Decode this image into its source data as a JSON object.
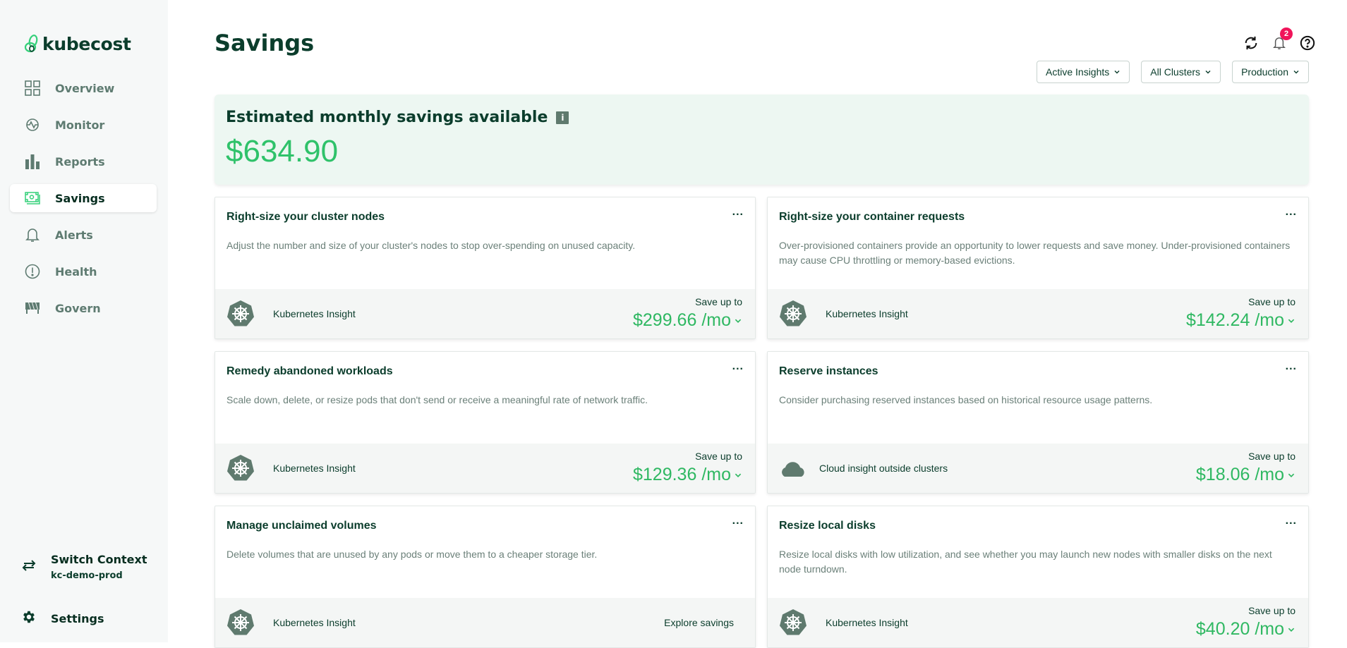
{
  "app": {
    "logo_text": "kubecost"
  },
  "sidebar": {
    "items": [
      {
        "label": "Overview",
        "icon": "grid-icon",
        "active": false
      },
      {
        "label": "Monitor",
        "icon": "pulse-icon",
        "active": false
      },
      {
        "label": "Reports",
        "icon": "bar-chart-icon",
        "active": false
      },
      {
        "label": "Savings",
        "icon": "money-icon",
        "active": true
      },
      {
        "label": "Alerts",
        "icon": "bell-icon",
        "active": false
      },
      {
        "label": "Health",
        "icon": "alert-circle-icon",
        "active": false
      },
      {
        "label": "Govern",
        "icon": "govern-icon",
        "active": false
      }
    ],
    "switch_context": {
      "title": "Switch Context",
      "context": "kc-demo-prod"
    },
    "settings_label": "Settings"
  },
  "header": {
    "title": "Savings",
    "notification_count": "2",
    "filters": [
      {
        "label": "Active Insights"
      },
      {
        "label": "All Clusters"
      },
      {
        "label": "Production"
      }
    ]
  },
  "banner": {
    "title": "Estimated monthly savings available",
    "info_icon": "i",
    "amount": "$634.90"
  },
  "cards": [
    {
      "title": "Right-size your cluster nodes",
      "description": "Adjust the number and size of your cluster's nodes to stop over-spending on unused capacity.",
      "source": "Kubernetes Insight",
      "source_type": "kubernetes",
      "save_label": "Save up to",
      "amount": "$299.66 /mo",
      "more": "..."
    },
    {
      "title": "Right-size your container requests",
      "description": "Over-provisioned containers provide an opportunity to lower requests and save money. Under-provisioned containers may cause CPU throttling or memory-based evictions.",
      "source": "Kubernetes Insight",
      "source_type": "kubernetes",
      "save_label": "Save up to",
      "amount": "$142.24 /mo",
      "more": "..."
    },
    {
      "title": "Remedy abandoned workloads",
      "description": "Scale down, delete, or resize pods that don't send or receive a meaningful rate of network traffic.",
      "source": "Kubernetes Insight",
      "source_type": "kubernetes",
      "save_label": "Save up to",
      "amount": "$129.36 /mo",
      "more": "..."
    },
    {
      "title": "Reserve instances",
      "description": "Consider purchasing reserved instances based on historical resource usage patterns.",
      "source": "Cloud insight outside clusters",
      "source_type": "cloud",
      "save_label": "Save up to",
      "amount": "$18.06 /mo",
      "more": "..."
    },
    {
      "title": "Manage unclaimed volumes",
      "description": "Delete volumes that are unused by any pods or move them to a cheaper storage tier.",
      "source": "Kubernetes Insight",
      "source_type": "kubernetes",
      "explore_label": "Explore savings",
      "more": "..."
    },
    {
      "title": "Resize local disks",
      "description": "Resize local disks with low utilization, and see whether you may launch new nodes with smaller disks on the next node turndown.",
      "source": "Kubernetes Insight",
      "source_type": "kubernetes",
      "save_label": "Save up to",
      "amount": "$40.20 /mo",
      "more": "..."
    }
  ],
  "colors": {
    "accent_green": "#2fc26a",
    "dark_green": "#0b3d2c",
    "muted_green": "#5e7b71",
    "badge_red": "#f0145a",
    "banner_bg": "#edf7f2"
  }
}
